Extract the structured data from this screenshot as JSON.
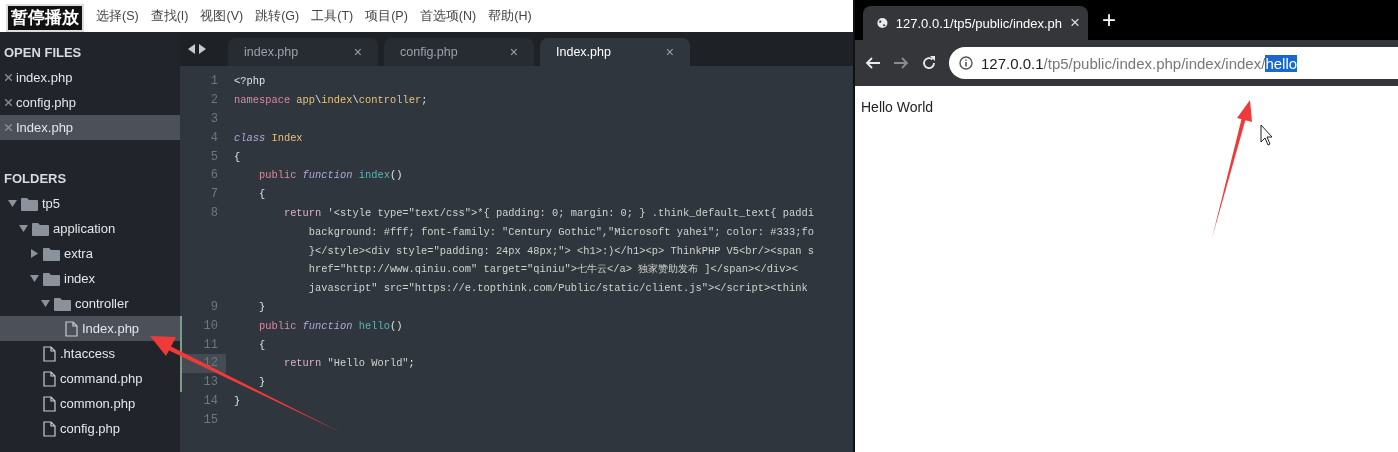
{
  "video_overlay": {
    "label": "暂停播放"
  },
  "menu": [
    "选择(S)",
    "查找(I)",
    "视图(V)",
    "跳转(G)",
    "工具(T)",
    "项目(P)",
    "首选项(N)",
    "帮助(H)"
  ],
  "sidebar": {
    "open_files_title": "OPEN FILES",
    "open_files": [
      {
        "name": "index.php",
        "selected": false
      },
      {
        "name": "config.php",
        "selected": false
      },
      {
        "name": "Index.php",
        "selected": true
      }
    ],
    "folders_title": "FOLDERS",
    "tree": [
      {
        "name": "tp5",
        "kind": "folder",
        "expanded": true,
        "selected": false,
        "children": [
          {
            "name": "application",
            "kind": "folder",
            "expanded": true,
            "selected": false,
            "children": [
              {
                "name": "extra",
                "kind": "folder",
                "expanded": false,
                "selected": false
              },
              {
                "name": "index",
                "kind": "folder",
                "expanded": true,
                "selected": false,
                "children": [
                  {
                    "name": "controller",
                    "kind": "folder",
                    "expanded": true,
                    "selected": false,
                    "children": [
                      {
                        "name": "Index.php",
                        "kind": "file",
                        "selected": true
                      }
                    ]
                  }
                ]
              },
              {
                "name": ".htaccess",
                "kind": "file",
                "selected": false
              },
              {
                "name": "command.php",
                "kind": "file",
                "selected": false
              },
              {
                "name": "common.php",
                "kind": "file",
                "selected": false
              },
              {
                "name": "config.php",
                "kind": "file",
                "selected": false
              }
            ]
          }
        ]
      }
    ]
  },
  "editor": {
    "tabs": [
      {
        "label": "index.php",
        "close": "×",
        "selected": false
      },
      {
        "label": "config.php",
        "close": "×",
        "selected": false
      },
      {
        "label": "Index.php",
        "close": "×",
        "selected": true
      }
    ],
    "lines": [
      {
        "number": "1",
        "modified": false,
        "current": false,
        "rows": [
          [
            {
              "kind": "plain",
              "text": "<?php"
            }
          ]
        ]
      },
      {
        "number": "2",
        "modified": false,
        "current": false,
        "rows": [
          [
            {
              "kind": "keyword",
              "text": "namespace "
            },
            {
              "kind": "entity",
              "text": "app"
            },
            {
              "kind": "plain",
              "text": "\\"
            },
            {
              "kind": "entity",
              "text": "index"
            },
            {
              "kind": "plain",
              "text": "\\"
            },
            {
              "kind": "entity",
              "text": "controller"
            },
            {
              "kind": "plain",
              "text": ";"
            }
          ]
        ]
      },
      {
        "number": "3",
        "modified": false,
        "current": false,
        "rows": [
          []
        ]
      },
      {
        "number": "4",
        "modified": false,
        "current": false,
        "rows": [
          [
            {
              "kind": "storage",
              "text": "class "
            },
            {
              "kind": "entity",
              "text": "Index"
            }
          ]
        ]
      },
      {
        "number": "5",
        "modified": false,
        "current": false,
        "rows": [
          [
            {
              "kind": "plain",
              "text": "{"
            }
          ]
        ]
      },
      {
        "number": "6",
        "modified": false,
        "current": false,
        "rows": [
          [
            {
              "kind": "plain",
              "text": "    "
            },
            {
              "kind": "keyword",
              "text": "public "
            },
            {
              "kind": "storage",
              "text": "function "
            },
            {
              "kind": "func",
              "text": "index"
            },
            {
              "kind": "plain",
              "text": "()"
            }
          ]
        ]
      },
      {
        "number": "7",
        "modified": false,
        "current": false,
        "rows": [
          [
            {
              "kind": "plain",
              "text": "    {"
            }
          ]
        ]
      },
      {
        "number": "8",
        "modified": false,
        "current": false,
        "rows": [
          [
            {
              "kind": "plain",
              "text": "        "
            },
            {
              "kind": "control",
              "text": "return "
            },
            {
              "kind": "string",
              "text": "'<style type=\"text/css\">*{ padding: 0; margin: 0; } .think_default_text{ paddi"
            }
          ],
          [
            {
              "kind": "string",
              "text": "            background: #fff; font-family: \"Century Gothic\",\"Microsoft yahei\"; color: #333;fo"
            }
          ],
          [
            {
              "kind": "string",
              "text": "            }</style><div style=\"padding: 24px 48px;\"> <h1>:)</h1><p> ThinkPHP V5<br/><span s"
            }
          ],
          [
            {
              "kind": "string",
              "text": "            href=\"http://www.qiniu.com\" target=\"qiniu\">七牛云</a> 独家赞助发布 ]</span></div><"
            }
          ],
          [
            {
              "kind": "string",
              "text": "            javascript\" src=\"https://e.topthink.com/Public/static/client.js\"></script><think"
            }
          ]
        ]
      },
      {
        "number": "9",
        "modified": false,
        "current": false,
        "rows": [
          [
            {
              "kind": "plain",
              "text": "    }"
            }
          ]
        ]
      },
      {
        "number": "10",
        "modified": true,
        "current": false,
        "rows": [
          [
            {
              "kind": "plain",
              "text": "    "
            },
            {
              "kind": "keyword",
              "text": "public "
            },
            {
              "kind": "storage",
              "text": "function "
            },
            {
              "kind": "func",
              "text": "hello"
            },
            {
              "kind": "plain",
              "text": "()"
            }
          ]
        ]
      },
      {
        "number": "11",
        "modified": true,
        "current": false,
        "rows": [
          [
            {
              "kind": "plain",
              "text": "    {"
            }
          ]
        ]
      },
      {
        "number": "12",
        "modified": true,
        "current": true,
        "rows": [
          [
            {
              "kind": "plain",
              "text": "        "
            },
            {
              "kind": "control",
              "text": "return "
            },
            {
              "kind": "string",
              "text": "\"Hello World\""
            },
            {
              "kind": "plain",
              "text": ";"
            }
          ]
        ]
      },
      {
        "number": "13",
        "modified": true,
        "current": false,
        "rows": [
          [
            {
              "kind": "plain",
              "text": "    }"
            }
          ]
        ]
      },
      {
        "number": "14",
        "modified": false,
        "current": false,
        "rows": [
          [
            {
              "kind": "plain",
              "text": "}"
            }
          ]
        ]
      },
      {
        "number": "15",
        "modified": false,
        "current": false,
        "rows": [
          []
        ]
      }
    ]
  },
  "browser": {
    "tab": {
      "title": "127.0.0.1/tp5/public/index.ph",
      "close": "×"
    },
    "new_tab": "+",
    "forward_disabled": true,
    "address": {
      "host": "127.0.0.1",
      "path": "/tp5/public/index.php/index/index/",
      "selected_text": "hello"
    },
    "page_text": "Hello World"
  }
}
